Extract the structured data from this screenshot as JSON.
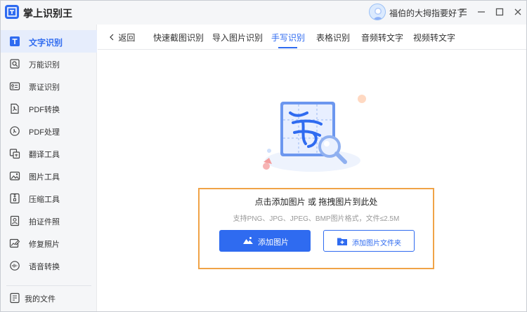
{
  "app": {
    "title": "掌上识别王",
    "accent": "#2f6bf0"
  },
  "user": {
    "name": "福伯的大拇指要好了"
  },
  "sidebar": {
    "items": [
      {
        "label": "文字识别",
        "icon": "text-recognition-icon",
        "active": true
      },
      {
        "label": "万能识别",
        "icon": "universal-scan-icon"
      },
      {
        "label": "票证识别",
        "icon": "ticket-icon"
      },
      {
        "label": "PDF转换",
        "icon": "pdf-convert-icon"
      },
      {
        "label": "PDF处理",
        "icon": "pdf-process-icon"
      },
      {
        "label": "翻译工具",
        "icon": "translate-icon"
      },
      {
        "label": "图片工具",
        "icon": "image-tool-icon"
      },
      {
        "label": "压缩工具",
        "icon": "compress-icon"
      },
      {
        "label": "拍证件照",
        "icon": "id-photo-icon"
      },
      {
        "label": "修复照片",
        "icon": "photo-repair-icon"
      },
      {
        "label": "语音转换",
        "icon": "voice-convert-icon"
      }
    ],
    "footer": {
      "label": "我的文件",
      "icon": "my-files-icon"
    }
  },
  "tabs": {
    "back_label": "返回",
    "items": [
      {
        "label": "快速截图识别"
      },
      {
        "label": "导入图片识别"
      },
      {
        "label": "手写识别",
        "active": true
      },
      {
        "label": "表格识别"
      },
      {
        "label": "音频转文字"
      },
      {
        "label": "视频转文字"
      }
    ]
  },
  "upload": {
    "title": "点击添加图片 或 拖拽图片到此处",
    "hint": "支持PNG、JPG、JPEG、BMP图片格式，文件≤2.5M",
    "add_image_label": "添加图片",
    "add_folder_label": "添加图片文件夹",
    "highlight_color": "#f0a347"
  }
}
